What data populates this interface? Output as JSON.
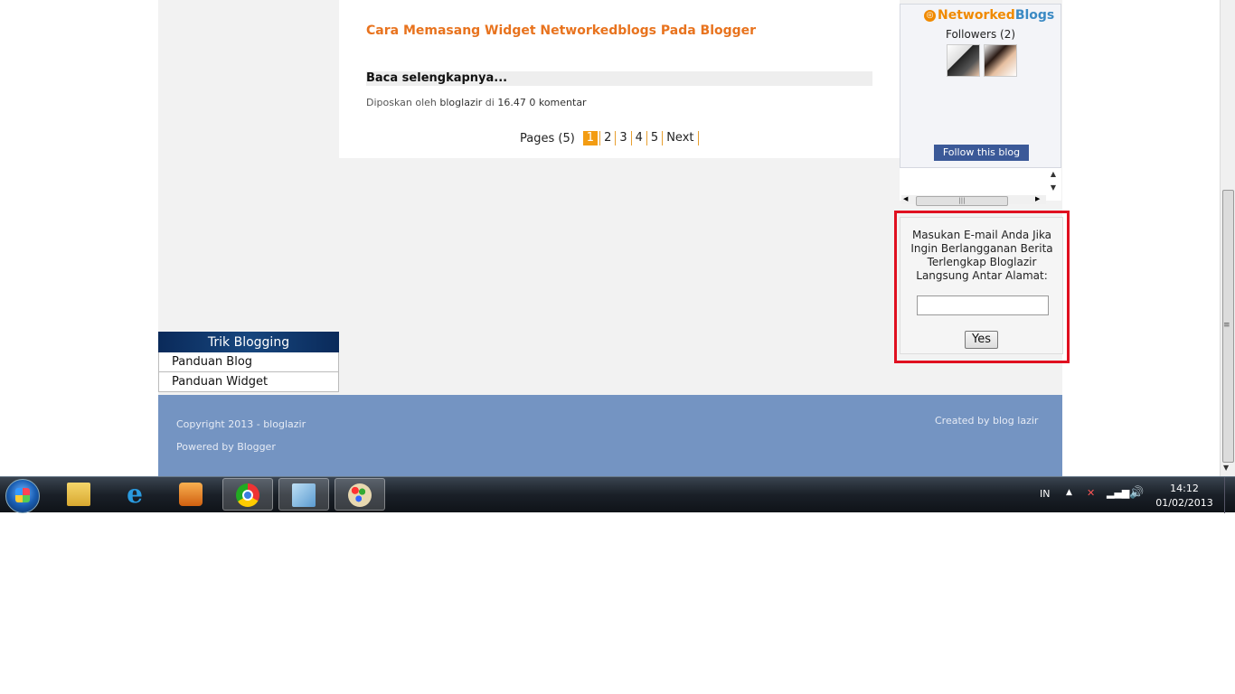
{
  "post": {
    "title": "Cara Memasang Widget Networkedblogs Pada Blogger",
    "read_more": "Baca selengkapnya...",
    "meta_prefix": "Diposkan oleh",
    "author": "bloglazir",
    "meta_at": "di",
    "time": "16.47",
    "comments": "0 komentar"
  },
  "pager": {
    "label": "Pages (5)",
    "pages": [
      "1",
      "2",
      "3",
      "4",
      "5"
    ],
    "current": "1",
    "next": "Next"
  },
  "networkedblogs": {
    "logo_networked": "Networked",
    "logo_blogs": "Blogs",
    "followers": "Followers (2)",
    "follow_button": "Follow this blog"
  },
  "subscribe": {
    "text": "Masukan E-mail Anda Jika Ingin Berlangganan Berita Terlengkap Bloglazir Langsung Antar Alamat:",
    "input_value": "",
    "button": "Yes",
    "highlight_color": "#e01020"
  },
  "widget": {
    "title": "Trik Blogging",
    "items": [
      "Panduan Blog",
      "Panduan Widget"
    ]
  },
  "footer": {
    "copyright": "Copyright 2013 - bloglazir",
    "powered": "Powered by Blogger",
    "created": "Created by blog lazir"
  },
  "taskbar": {
    "apps": [
      "windows-explorer",
      "internet-explorer",
      "media-player",
      "google-chrome",
      "notes",
      "paint"
    ],
    "active_app": "google-chrome",
    "language": "IN",
    "time": "14:12",
    "date": "01/02/2013"
  },
  "colors": {
    "accent_orange": "#e8731e",
    "footer_bg": "#7494c2",
    "widget_header": "#17467e"
  }
}
